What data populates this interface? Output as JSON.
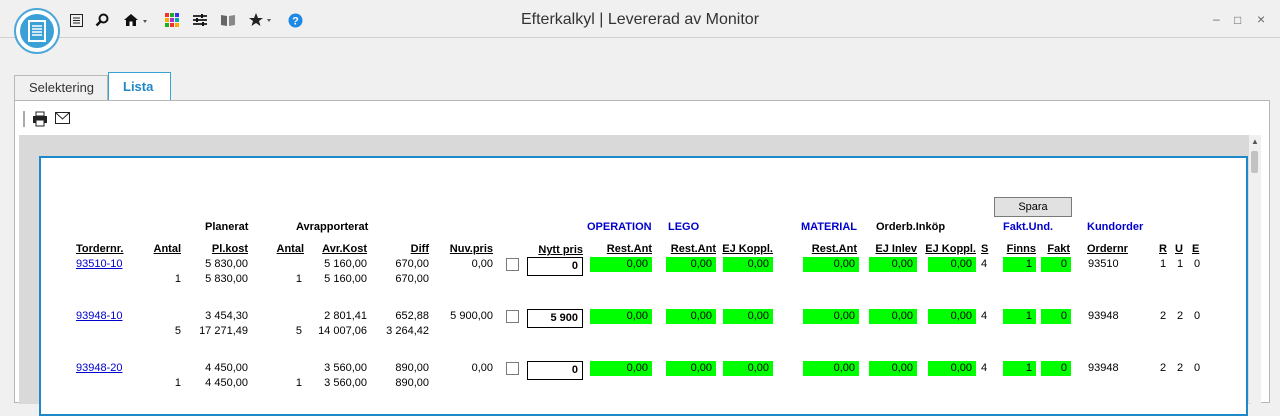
{
  "window": {
    "title": "Efterkalkyl | Levererad av Monitor"
  },
  "tabs": [
    {
      "label": "Selektering"
    },
    {
      "label": "Lista"
    }
  ],
  "sheet": {
    "save_label": "Spara",
    "group_headers": {
      "planerat": "Planerat",
      "avrapporterat": "Avrapporterat",
      "operation": "OPERATION",
      "lego": "LEGO",
      "material": "MATERIAL",
      "orderb_inkop": "Orderb.Inköp",
      "fakt_und": "Fakt.Und.",
      "kundorder": "Kundorder"
    },
    "columns": {
      "tordernr": "Tordernr.",
      "antal": "Antal",
      "pl_kost": "Pl.kost",
      "antal2": "Antal",
      "avr_kost": "Avr.Kost",
      "diff": "Diff",
      "nuv_pris": "Nuv.pris",
      "nytt_pris": "Nytt pris",
      "op_rest_ant": "Rest.Ant",
      "lego_rest_ant": "Rest.Ant",
      "lego_ej_koppl": "EJ Koppl.",
      "mat_rest_ant": "Rest.Ant",
      "ej_inlev": "EJ Inlev",
      "ej_koppl": "EJ Koppl.",
      "s": "S",
      "finns": "Finns",
      "fakt": "Fakt",
      "ordernr": "Ordernr",
      "r": "R",
      "u": "U",
      "e": "E"
    },
    "rows": [
      {
        "tordernr": "93510-10",
        "pl_kost": "5 830,00",
        "avr_kost": "5 160,00",
        "diff": "670,00",
        "nuv_pris": "0,00",
        "nytt_pris": "0",
        "op_rest_ant": "0,00",
        "lego_rest_ant": "0,00",
        "lego_ej_koppl": "0,00",
        "mat_rest_ant": "0,00",
        "ej_inlev": "0,00",
        "ej_koppl": "0,00",
        "s": "4",
        "finns": "1",
        "fakt": "0",
        "ordernr": "93510",
        "r": "1",
        "u": "1",
        "e": "0",
        "sub": {
          "antal": "1",
          "pl_kost": "5 830,00",
          "antal2": "1",
          "avr_kost": "5 160,00",
          "diff": "670,00"
        }
      },
      {
        "tordernr": "93948-10",
        "pl_kost": "3 454,30",
        "avr_kost": "2 801,41",
        "diff": "652,88",
        "nuv_pris": "5 900,00",
        "nytt_pris": "5 900",
        "op_rest_ant": "0,00",
        "lego_rest_ant": "0,00",
        "lego_ej_koppl": "0,00",
        "mat_rest_ant": "0,00",
        "ej_inlev": "0,00",
        "ej_koppl": "0,00",
        "s": "4",
        "finns": "1",
        "fakt": "0",
        "ordernr": "93948",
        "r": "2",
        "u": "2",
        "e": "0",
        "sub": {
          "antal": "5",
          "pl_kost": "17 271,49",
          "antal2": "5",
          "avr_kost": "14 007,06",
          "diff": "3 264,42"
        }
      },
      {
        "tordernr": "93948-20",
        "pl_kost": "4 450,00",
        "avr_kost": "3 560,00",
        "diff": "890,00",
        "nuv_pris": "0,00",
        "nytt_pris": "0",
        "op_rest_ant": "0,00",
        "lego_rest_ant": "0,00",
        "lego_ej_koppl": "0,00",
        "mat_rest_ant": "0,00",
        "ej_inlev": "0,00",
        "ej_koppl": "0,00",
        "s": "4",
        "finns": "1",
        "fakt": "0",
        "ordernr": "93948",
        "r": "2",
        "u": "2",
        "e": "0",
        "sub": {
          "antal": "1",
          "pl_kost": "4 450,00",
          "antal2": "1",
          "avr_kost": "3 560,00",
          "diff": "890,00"
        }
      }
    ]
  },
  "colors": {
    "accent": "#3ba0d6",
    "green_cell": "#00ff00",
    "link": "#0000cc"
  },
  "icons": [
    "list-icon",
    "search-icon",
    "home-icon",
    "grid-icon",
    "settings-sliders-icon",
    "book-icon",
    "star-icon",
    "help-icon",
    "print-icon",
    "mail-icon"
  ]
}
